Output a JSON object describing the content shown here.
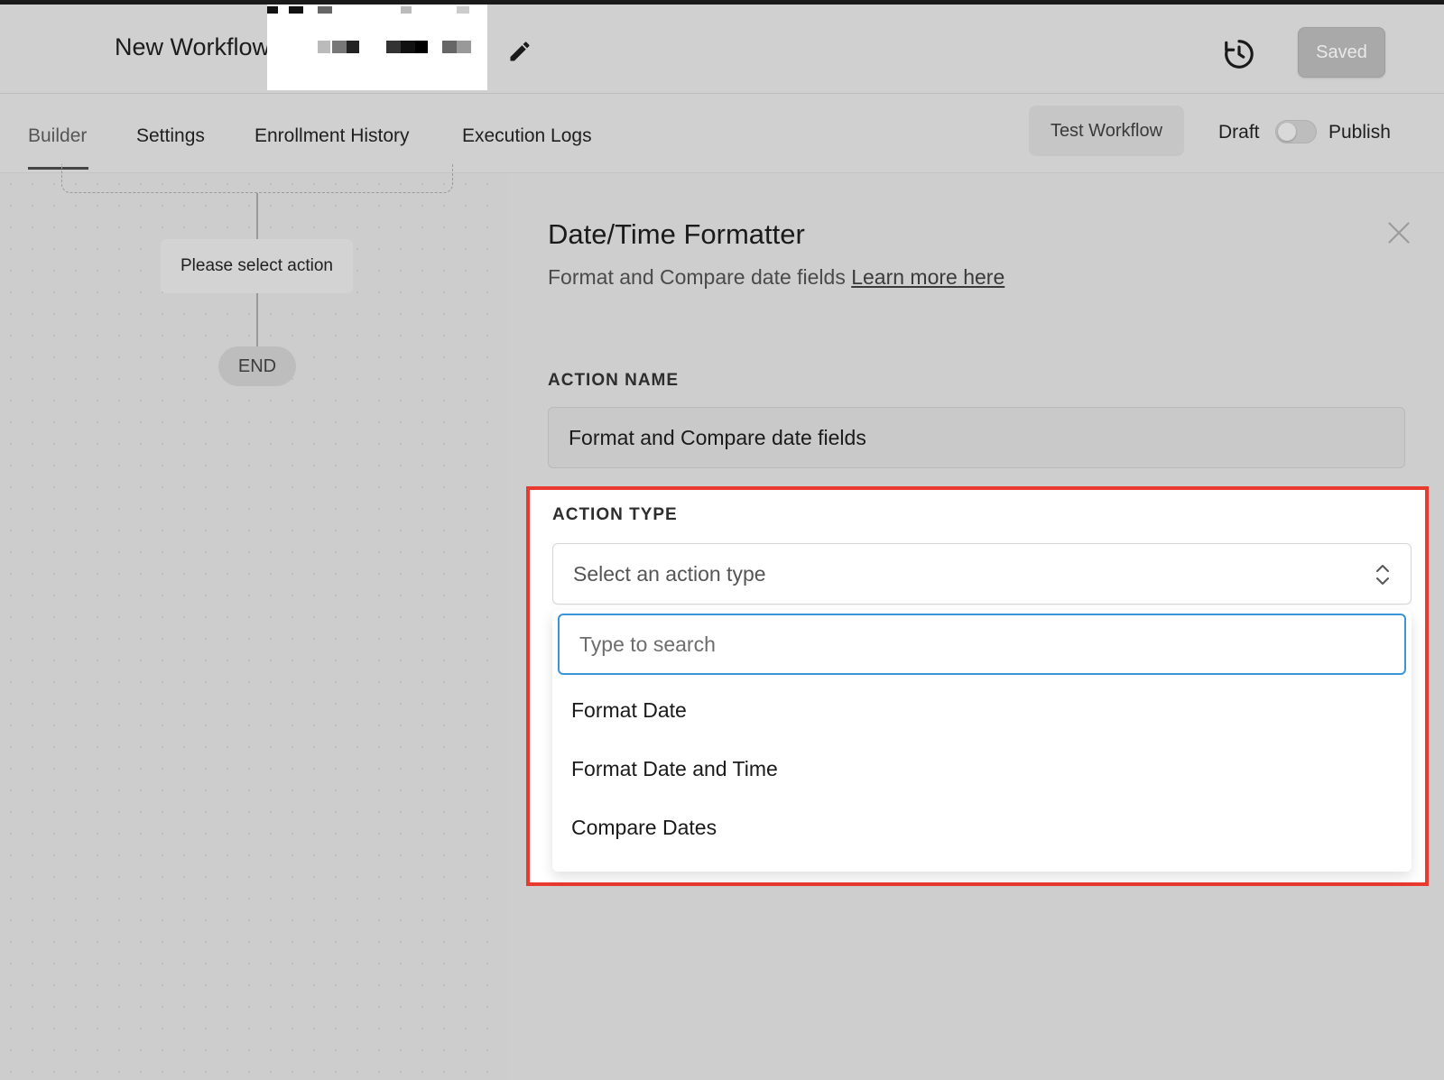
{
  "header": {
    "workflow_title": "New Workflow",
    "saved_label": "Saved"
  },
  "tabs": [
    {
      "label": "Builder",
      "active": true
    },
    {
      "label": "Settings"
    },
    {
      "label": "Enrollment History"
    },
    {
      "label": "Execution Logs"
    }
  ],
  "toolbar": {
    "test_workflow_label": "Test Workflow",
    "draft_label": "Draft",
    "publish_label": "Publish",
    "publish_enabled": false
  },
  "canvas": {
    "action_node_label": "Please select action",
    "end_node_label": "END"
  },
  "panel": {
    "title": "Date/Time Formatter",
    "subtitle": "Format and Compare date fields",
    "learn_more_link": "Learn more here",
    "action_name_label": "ACTION NAME",
    "action_name_value": "Format and Compare date fields",
    "action_type_label": "ACTION TYPE",
    "action_type_placeholder": "Select an action type",
    "search_placeholder": "Type to search",
    "options": [
      "Format Date",
      "Format Date and Time",
      "Compare Dates"
    ]
  },
  "colors": {
    "highlight_border": "#e83a2e",
    "focus_border": "#3a95d8"
  },
  "icons": [
    "pencil-icon",
    "history-clock-icon",
    "close-icon",
    "chevron-updown-icon"
  ]
}
